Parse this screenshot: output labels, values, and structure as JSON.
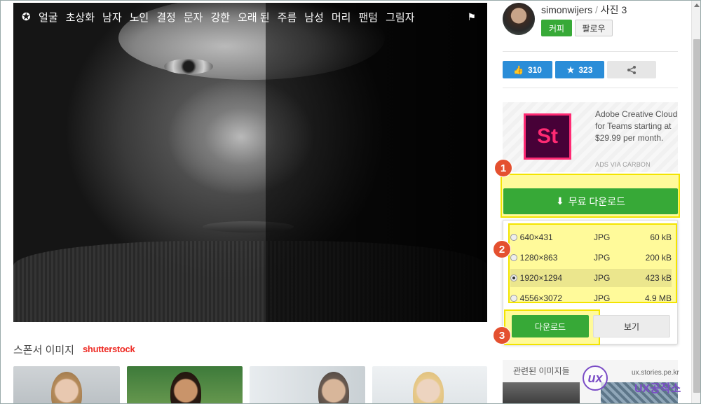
{
  "hero": {
    "tags": [
      "얼굴",
      "초상화",
      "남자",
      "노인",
      "결정",
      "문자",
      "강한",
      "오래 된",
      "주름",
      "남성",
      "머리",
      "팬텀",
      "그림자"
    ],
    "tag_icon": "award-icon",
    "flag_icon": "flag-icon"
  },
  "sponsor": {
    "title": "스폰서 이미지",
    "logo_text": "shutterstock"
  },
  "author": {
    "name": "simonwijers",
    "separator": "/",
    "photos": "사진 3",
    "copy_label": "커피",
    "follow_label": "팔로우"
  },
  "stats": {
    "likes": "310",
    "stars": "323"
  },
  "ad": {
    "logo_text": "St",
    "text": "Adobe Creative Cloud for Teams starting at $29.99 per month.",
    "via": "ADS VIA CARBON"
  },
  "download": {
    "button_label": "무료 다운로드",
    "options": [
      {
        "res": "640×431",
        "fmt": "JPG",
        "size": "60 kB",
        "selected": false
      },
      {
        "res": "1280×863",
        "fmt": "JPG",
        "size": "200 kB",
        "selected": false
      },
      {
        "res": "1920×1294",
        "fmt": "JPG",
        "size": "423 kB",
        "selected": true
      },
      {
        "res": "4556×3072",
        "fmt": "JPG",
        "size": "4.9 MB",
        "selected": false
      }
    ],
    "download_label": "다운로드",
    "view_label": "보기"
  },
  "markers": [
    "1",
    "2",
    "3"
  ],
  "related": {
    "title": "관련된 이미지들"
  },
  "watermark": {
    "logo_text": "ux",
    "url": "ux.stories.pe.kr",
    "name": "UX공작소"
  },
  "colors": {
    "green": "#37a937",
    "blue": "#2a8dd8",
    "highlight": "#f3e400",
    "marker": "#e4502f"
  }
}
